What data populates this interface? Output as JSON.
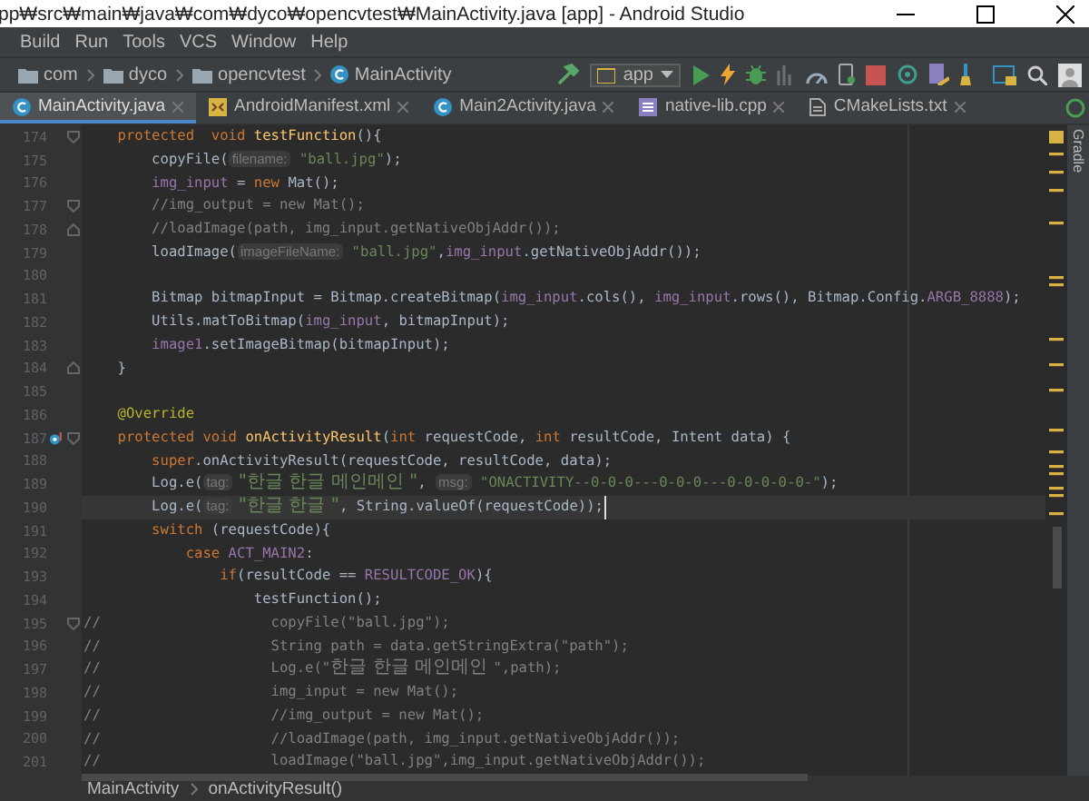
{
  "window": {
    "title": "pp₩src₩main₩java₩com₩dyco₩opencvtest₩MainActivity.java [app] - Android Studio"
  },
  "menu": [
    "Build",
    "Run",
    "Tools",
    "VCS",
    "Window",
    "Help"
  ],
  "nav_path": [
    {
      "kind": "folder",
      "label": "com"
    },
    {
      "kind": "folder",
      "label": "dyco"
    },
    {
      "kind": "folder",
      "label": "opencvtest"
    },
    {
      "kind": "class",
      "label": "MainActivity"
    }
  ],
  "run_config": {
    "label": "app"
  },
  "tabs": [
    {
      "kind": "class",
      "label": "MainActivity.java",
      "selected": true
    },
    {
      "kind": "manifest",
      "label": "AndroidManifest.xml",
      "selected": false
    },
    {
      "kind": "class",
      "label": "Main2Activity.java",
      "selected": false
    },
    {
      "kind": "cpp",
      "label": "native-lib.cpp",
      "selected": false
    },
    {
      "kind": "text",
      "label": "CMakeLists.txt",
      "selected": false
    }
  ],
  "lines": [
    {
      "number": "174",
      "current": false,
      "fold_start": true,
      "tokens": [
        {
          "kind": "kw",
          "text": "    protected"
        },
        {
          "kind": "kw",
          "text": "  void"
        },
        {
          "kind": "decl",
          "text": " testFunction"
        },
        {
          "kind": "plain",
          "text": "(){"
        }
      ]
    },
    {
      "number": "175",
      "current": false,
      "tokens": [
        {
          "kind": "plain",
          "text": "        copyFile("
        },
        {
          "kind": "hint",
          "text": "filename:"
        },
        {
          "kind": "string",
          "text": " \"ball.jpg\""
        },
        {
          "kind": "plain",
          "text": ");"
        }
      ]
    },
    {
      "number": "176",
      "current": false,
      "tokens": [
        {
          "kind": "field",
          "text": "        img_input"
        },
        {
          "kind": "plain",
          "text": " = "
        },
        {
          "kind": "kw",
          "text": "new"
        },
        {
          "kind": "plain",
          "text": " Mat();"
        }
      ]
    },
    {
      "number": "177",
      "current": false,
      "fold_start": true,
      "tokens": [
        {
          "kind": "comment",
          "text": "        //img_output = new Mat();"
        }
      ]
    },
    {
      "number": "178",
      "current": false,
      "fold_end": true,
      "tokens": [
        {
          "kind": "comment",
          "text": "        //loadImage(path, img_input.getNativeObjAddr());"
        }
      ]
    },
    {
      "number": "179",
      "current": false,
      "tokens": [
        {
          "kind": "plain",
          "text": "        loadImage("
        },
        {
          "kind": "hint",
          "text": "imageFileName:"
        },
        {
          "kind": "string",
          "text": " \"ball.jpg\""
        },
        {
          "kind": "plain",
          "text": ","
        },
        {
          "kind": "field",
          "text": "img_input"
        },
        {
          "kind": "plain",
          "text": ".getNativeObjAddr());"
        }
      ]
    },
    {
      "number": "180",
      "current": false
    },
    {
      "number": "181",
      "current": false,
      "tokens": [
        {
          "kind": "plain",
          "text": "        Bitmap bitmapInput = Bitmap.createBitmap("
        },
        {
          "kind": "field",
          "text": "img_input"
        },
        {
          "kind": "plain",
          "text": ".cols(), "
        },
        {
          "kind": "field",
          "text": "img_input"
        },
        {
          "kind": "plain",
          "text": ".rows(), Bitmap.Config."
        },
        {
          "kind": "field",
          "text": "ARGB_8888"
        },
        {
          "kind": "plain",
          "text": ");"
        }
      ]
    },
    {
      "number": "182",
      "current": false,
      "tokens": [
        {
          "kind": "plain",
          "text": "        Utils.matToBitmap("
        },
        {
          "kind": "field",
          "text": "img_input"
        },
        {
          "kind": "plain",
          "text": ", bitmapInput);"
        }
      ]
    },
    {
      "number": "183",
      "current": false,
      "tokens": [
        {
          "kind": "field",
          "text": "        image1"
        },
        {
          "kind": "plain",
          "text": ".setImageBitmap(bitmapInput);"
        }
      ]
    },
    {
      "number": "184",
      "current": false,
      "fold_end": true,
      "tokens": [
        {
          "kind": "plain",
          "text": "    }"
        }
      ]
    },
    {
      "number": "185",
      "current": false
    },
    {
      "number": "186",
      "current": false,
      "tokens": [
        {
          "kind": "annotation",
          "text": "    @Override"
        }
      ]
    },
    {
      "number": "187",
      "current": false,
      "fold_start": true,
      "overridden": true,
      "tokens": [
        {
          "kind": "kw",
          "text": "    protected void"
        },
        {
          "kind": "decl",
          "text": " onActivityResult"
        },
        {
          "kind": "plain",
          "text": "("
        },
        {
          "kind": "kw",
          "text": "int"
        },
        {
          "kind": "plain",
          "text": " requestCode, "
        },
        {
          "kind": "kw",
          "text": "int"
        },
        {
          "kind": "plain",
          "text": " resultCode, Intent data) {"
        }
      ]
    },
    {
      "number": "188",
      "current": false,
      "tokens": [
        {
          "kind": "kw",
          "text": "        super"
        },
        {
          "kind": "plain",
          "text": ".onActivityResult(requestCode, resultCode, data);"
        }
      ]
    },
    {
      "number": "189",
      "current": false,
      "tokens": [
        {
          "kind": "plain",
          "text": "        Log.e("
        },
        {
          "kind": "hint",
          "text": "tag:"
        },
        {
          "kind": "string_hangul",
          "text": " \"한글 한글 메인메인 \""
        },
        {
          "kind": "plain",
          "text": ", "
        },
        {
          "kind": "hint",
          "text": "msg:"
        },
        {
          "kind": "string",
          "text": " \"ONACTIVITY--0-0-0---0-0-0---0-0-0-0-0-\""
        },
        {
          "kind": "plain",
          "text": ");"
        }
      ]
    },
    {
      "number": "190",
      "current": true,
      "tokens": [
        {
          "kind": "plain",
          "text": "        Log.e("
        },
        {
          "kind": "hint",
          "text": "tag:"
        },
        {
          "kind": "string_hangul",
          "text": " \"한글 한글 \""
        },
        {
          "kind": "plain",
          "text": ", String.valueOf(requestCode));"
        }
      ]
    },
    {
      "number": "191",
      "current": false,
      "tokens": [
        {
          "kind": "kw",
          "text": "        switch"
        },
        {
          "kind": "plain",
          "text": " (requestCode){"
        }
      ]
    },
    {
      "number": "192",
      "current": false,
      "tokens": [
        {
          "kind": "kw",
          "text": "            case"
        },
        {
          "kind": "field",
          "text": " ACT_MAIN2"
        },
        {
          "kind": "plain",
          "text": ":"
        }
      ]
    },
    {
      "number": "193",
      "current": false,
      "tokens": [
        {
          "kind": "kw",
          "text": "                if"
        },
        {
          "kind": "plain",
          "text": "(resultCode == "
        },
        {
          "kind": "field",
          "text": "RESULTCODE_OK"
        },
        {
          "kind": "plain",
          "text": "){"
        }
      ]
    },
    {
      "number": "194",
      "current": false,
      "tokens": [
        {
          "kind": "plain",
          "text": "                    testFunction();"
        }
      ]
    },
    {
      "number": "195",
      "current": false,
      "fold_start": true,
      "tokens": [
        {
          "kind": "comment",
          "text": "//                    copyFile(\"ball.jpg\");"
        }
      ]
    },
    {
      "number": "196",
      "current": false,
      "tokens": [
        {
          "kind": "comment",
          "text": "//                    String path = data.getStringExtra(\"path\");"
        }
      ]
    },
    {
      "number": "197",
      "current": false,
      "tokens": [
        {
          "kind": "comment",
          "text": "//                    Log.e(\""
        },
        {
          "kind": "comment_hangul",
          "text": "한글 한글 메인메인 "
        },
        {
          "kind": "comment",
          "text": "\",path);"
        }
      ]
    },
    {
      "number": "198",
      "current": false,
      "tokens": [
        {
          "kind": "comment",
          "text": "//                    img_input = new Mat();"
        }
      ]
    },
    {
      "number": "199",
      "current": false,
      "tokens": [
        {
          "kind": "comment",
          "text": "//                    //img_output = new Mat();"
        }
      ]
    },
    {
      "number": "200",
      "current": false,
      "tokens": [
        {
          "kind": "comment",
          "text": "//                    //loadImage(path, img_input.getNativeObjAddr());"
        }
      ]
    },
    {
      "number": "201",
      "current": false,
      "tokens": [
        {
          "kind": "comment",
          "text": "//                    loadImage(\"ball.jpg\",img_input.getNativeObjAddr());"
        }
      ]
    }
  ],
  "side_panel": {
    "label": "Gradle"
  },
  "breadcrumbs": [
    "MainActivity",
    "onActivityResult()"
  ]
}
